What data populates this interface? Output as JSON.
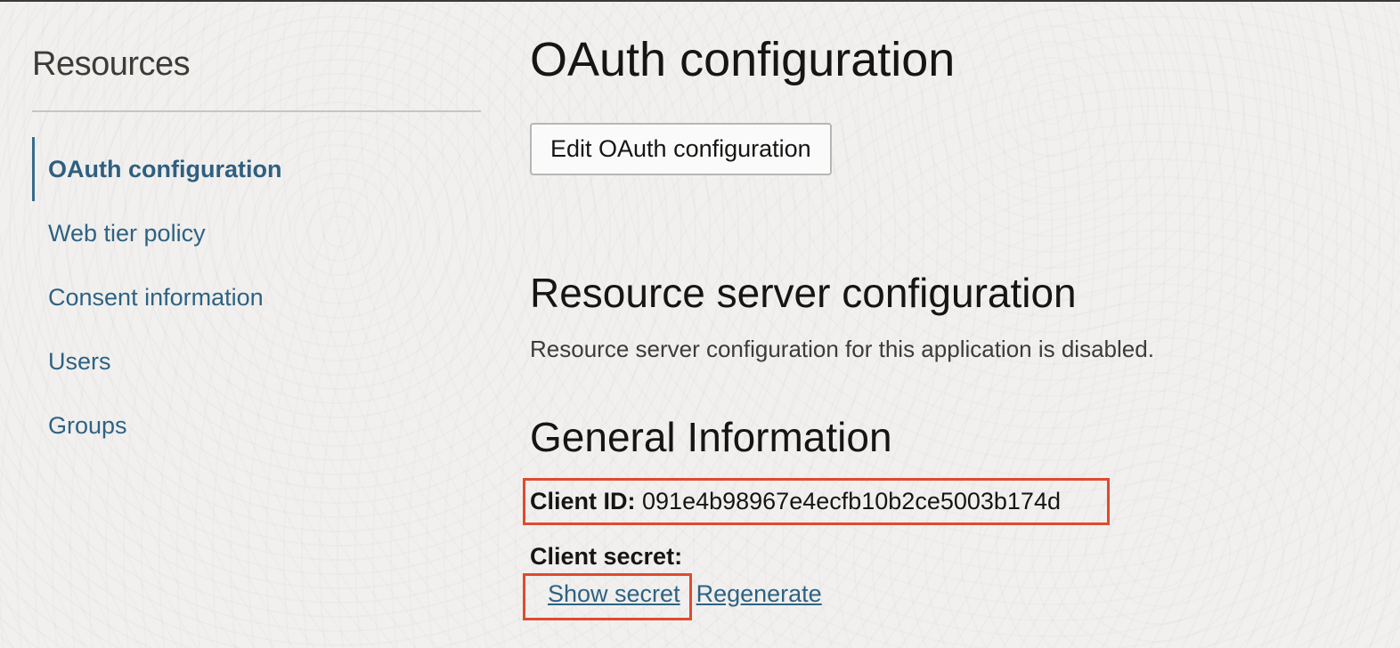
{
  "sidebar": {
    "title": "Resources",
    "items": [
      {
        "label": "OAuth configuration",
        "active": true
      },
      {
        "label": "Web tier policy",
        "active": false
      },
      {
        "label": "Consent information",
        "active": false
      },
      {
        "label": "Users",
        "active": false
      },
      {
        "label": "Groups",
        "active": false
      }
    ]
  },
  "main": {
    "title": "OAuth configuration",
    "edit_button_label": "Edit OAuth configuration",
    "resource_server": {
      "title": "Resource server configuration",
      "description": "Resource server configuration for this application is disabled."
    },
    "general_info": {
      "title": "General Information",
      "client_id_label": "Client ID:",
      "client_id_value": "091e4b98967e4ecfb10b2ce5003b174d",
      "client_secret_label": "Client secret:",
      "show_secret_label": "Show secret",
      "regenerate_label": "Regenerate"
    }
  },
  "colors": {
    "link": "#2e6283",
    "highlight": "#e04a2f",
    "background": "#f1f0ee"
  }
}
